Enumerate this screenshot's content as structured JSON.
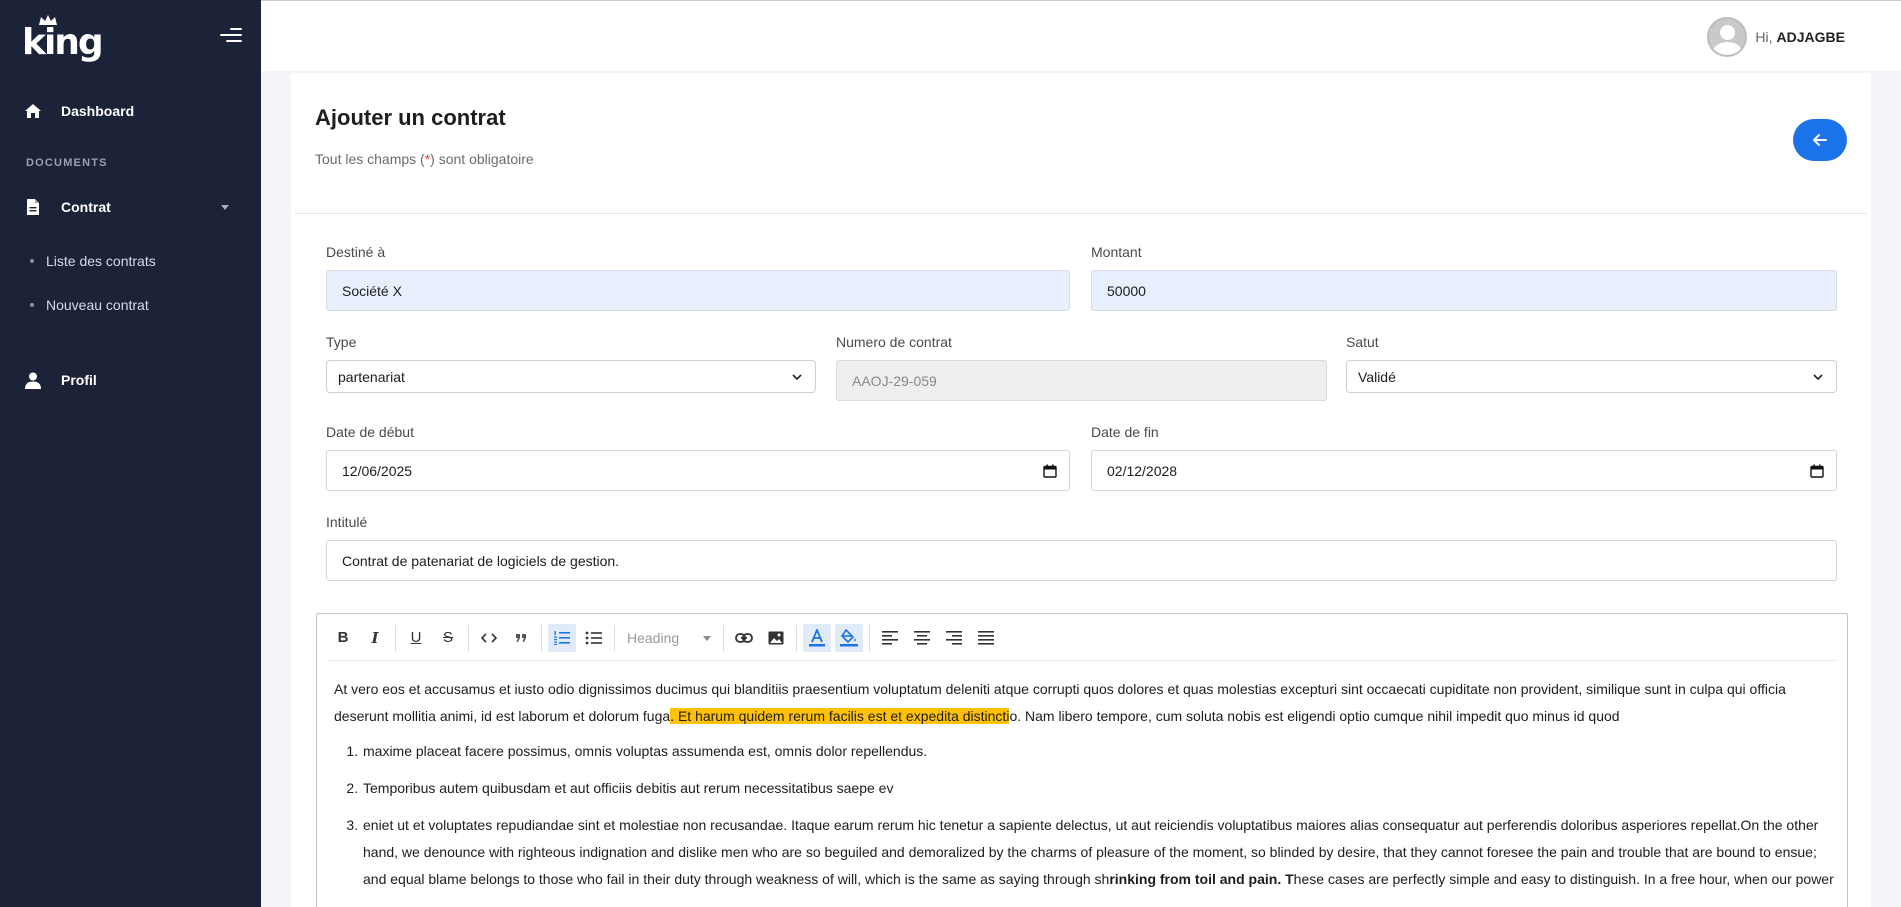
{
  "sidebar": {
    "logo_text": "king",
    "dashboard_label": "Dashboard",
    "section_documents": "DOCUMENTS",
    "contrat_label": "Contrat",
    "sub_items": [
      "Liste des contrats",
      "Nouveau contrat"
    ],
    "profil_label": "Profil",
    "bg_color": "#1c2238"
  },
  "topbar": {
    "greeting": "Hi,",
    "username": "ADJAGBE"
  },
  "page": {
    "title": "Ajouter un contrat",
    "subtitle_before": "Tout les champs (",
    "subtitle_req": "*",
    "subtitle_after": ") sont obligatoire",
    "accent_color": "#1a73e8"
  },
  "form": {
    "destine_label": "Destiné à",
    "destine_value": "Société X",
    "montant_label": "Montant",
    "montant_value": "50000",
    "type_label": "Type",
    "type_value": "partenariat",
    "numero_label": "Numero de contrat",
    "numero_value": "AAOJ-29-059",
    "statut_label": "Satut",
    "statut_value": "Validé",
    "debut_label": "Date de début",
    "debut_value": "12/06/2025",
    "fin_label": "Date de fin",
    "fin_value": "02/12/2028",
    "intitule_label": "Intitulé",
    "intitule_value": "Contrat de patenariat de logiciels de gestion."
  },
  "editor": {
    "heading_placeholder": "Heading",
    "para_part1": "At vero eos et accusamus et iusto odio dignissimos ducimus qui blanditiis praesentium voluptatum deleniti atque corrupti quos dolores et quas molestias excepturi sint occaecati cupiditate non provident, similique sunt in culpa qui officia deserunt mollitia animi, id est laborum et dolorum fuga",
    "para_highlight": ". Et harum quidem rerum facilis est et expedita distincti",
    "para_part2": "o. Nam libero tempore, cum soluta nobis est eligendi optio cumque nihil impedit quo minus id quod",
    "list_item1": "maxime placeat facere possimus, omnis voluptas assumenda est, omnis dolor repellendus.",
    "list_item2": "Temporibus autem quibusdam et aut officiis debitis aut rerum necessitatibus saepe ev",
    "list_item3_part1": "eniet ut et voluptates repudiandae sint et molestiae non recusandae. Itaque earum rerum hic tenetur a sapiente delectus, ut aut reiciendis voluptatibus maiores alias consequatur aut perferendis doloribus asperiores repellat.On the other hand, we denounce with righteous indignation and dislike men who are so beguiled and demoralized by the charms of pleasure of the moment, so blinded by desire, that they cannot foresee the pain and trouble that are bound to ensue; and equal blame belongs to those who fail in their duty through weakness of will, which is the same as saying through sh",
    "list_item3_bold": "rinking from toil and pain. T",
    "list_item3_part2": "hese cases are perfectly simple and easy to distinguish. In a free hour, when our power",
    "highlight_color": "#ffc107"
  }
}
